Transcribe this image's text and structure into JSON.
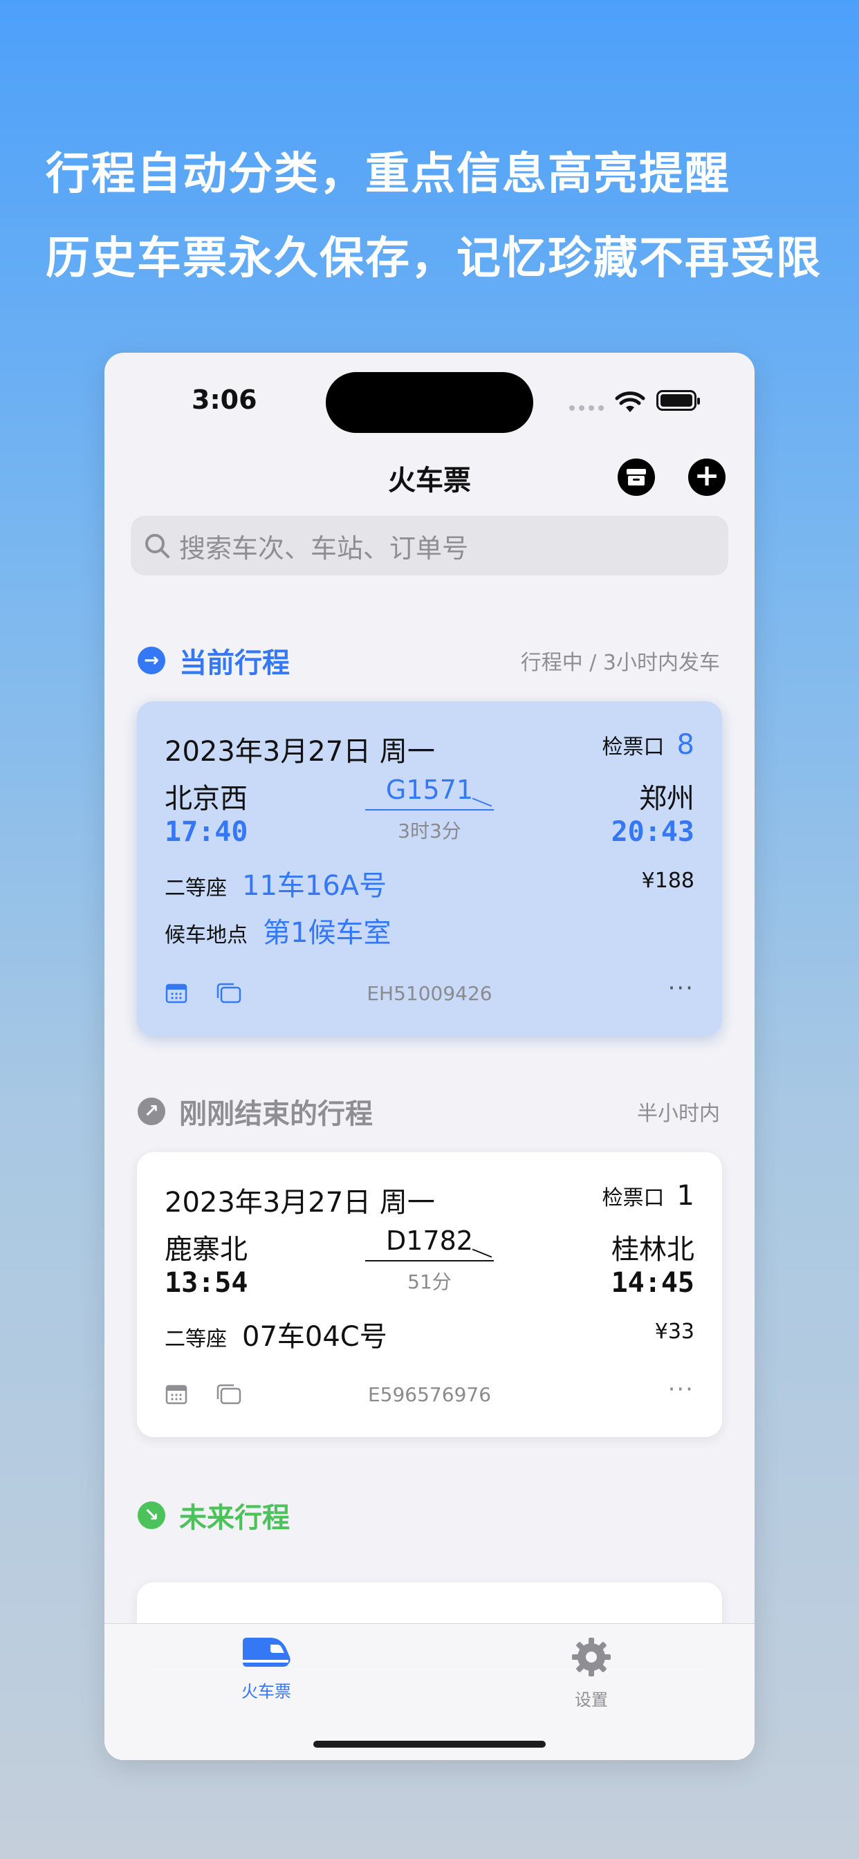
{
  "promo": {
    "line1": "行程自动分类，重点信息高亮提醒",
    "line2": "历史车票永久保存，记忆珍藏不再受限"
  },
  "status_bar": {
    "time": "3:06"
  },
  "nav": {
    "title": "火车票",
    "archive_icon": "archive-box-icon",
    "add_icon": "plus-circle-icon"
  },
  "search": {
    "placeholder": "搜索车次、车站、订单号"
  },
  "colors": {
    "accent": "#3478f6",
    "gray": "#8e8e93",
    "green": "#4cc25a"
  },
  "sections": {
    "current": {
      "title": "当前行程",
      "note": "行程中 / 3小时内发车",
      "icon": "arrow-right-circle-icon"
    },
    "recent": {
      "title": "刚刚结束的行程",
      "note": "半小时内",
      "icon": "arrow-up-right-circle-icon"
    },
    "future": {
      "title": "未来行程",
      "icon": "arrow-down-right-circle-icon"
    }
  },
  "tickets": [
    {
      "date": "2023年3月27日 周一",
      "gate_label": "检票口",
      "gate": "8",
      "from": "北京西",
      "to": "郑州",
      "train": "G1571",
      "duration": "3时3分",
      "depart": "17:40",
      "arrive": "20:43",
      "seat_class": "二等座",
      "seat": "11车16A号",
      "price": "¥188",
      "wait_label": "候车地点",
      "wait_room": "第1候车室",
      "order_no": "EH51009426",
      "more": "···"
    },
    {
      "date": "2023年3月27日 周一",
      "gate_label": "检票口",
      "gate": "1",
      "from": "鹿寨北",
      "to": "桂林北",
      "train": "D1782",
      "duration": "51分",
      "depart": "13:54",
      "arrive": "14:45",
      "seat_class": "二等座",
      "seat": "07车04C号",
      "price": "¥33",
      "order_no": "E596576976",
      "more": "···"
    }
  ],
  "tabbar": {
    "tabs": [
      {
        "label": "火车票",
        "icon": "train-ticket-icon",
        "active": true
      },
      {
        "label": "设置",
        "icon": "gear-icon",
        "active": false
      }
    ]
  }
}
